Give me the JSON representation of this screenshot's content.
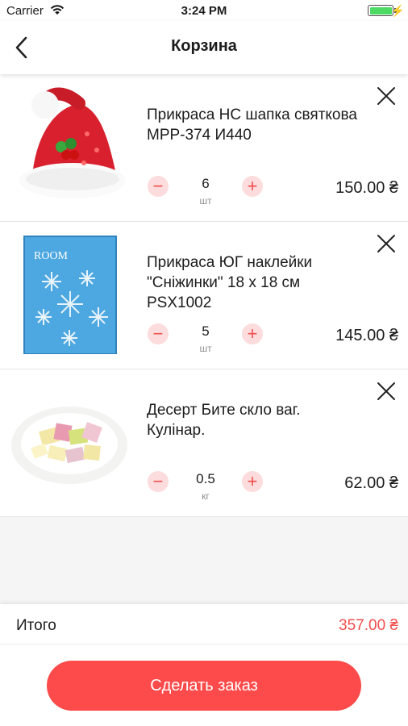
{
  "status_bar": {
    "carrier": "Carrier",
    "time": "3:24 PM",
    "battery_level": 1.0
  },
  "nav": {
    "title": "Корзина",
    "back_icon": "chevron-left-icon"
  },
  "items": [
    {
      "name": "Прикраса НС шапка святкова MPP-374 И440",
      "quantity": "6",
      "unit": "шт",
      "price": "150.00 ₴",
      "image": "santa-hat-icon"
    },
    {
      "name": "Прикраса ЮГ наклейки \"Сніжинки\" 18 х 18 см PSX1002",
      "quantity": "5",
      "unit": "шт",
      "price": "145.00 ₴",
      "image": "snowflake-stickers-icon"
    },
    {
      "name": "Десерт Бите скло ваг. Кулінар.",
      "quantity": "0.5",
      "unit": "кг",
      "price": "62.00 ₴",
      "image": "dessert-plate-icon"
    }
  ],
  "summary": {
    "total_label": "Итого",
    "total_value": "357.00 ₴"
  },
  "order_button": "Сделать заказ",
  "colors": {
    "accent": "#fd4b4b",
    "accent_light": "#fcdcdc",
    "battery": "#4cd964"
  }
}
